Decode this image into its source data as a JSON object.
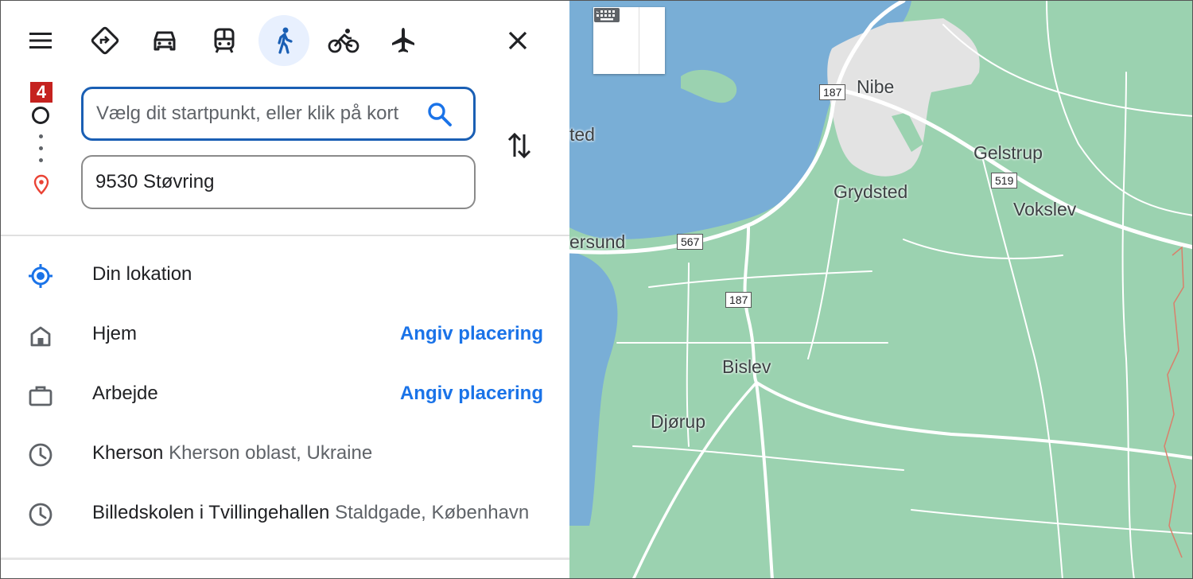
{
  "app": {
    "mode_count_badge": "4"
  },
  "travel_modes": [
    {
      "name": "best-route-icon",
      "active": false
    },
    {
      "name": "car-icon",
      "active": false
    },
    {
      "name": "transit-icon",
      "active": false
    },
    {
      "name": "walking-icon",
      "active": true
    },
    {
      "name": "bicycle-icon",
      "active": false
    },
    {
      "name": "flight-icon",
      "active": false
    }
  ],
  "inputs": {
    "start_placeholder": "Vælg dit startpunkt, eller klik på kort",
    "start_value": "",
    "destination_value": "9530 Støvring"
  },
  "suggestions": [
    {
      "icon": "my-location-icon",
      "name": "Din lokation",
      "sub": "",
      "action": ""
    },
    {
      "icon": "home-icon",
      "name": "Hjem",
      "sub": "",
      "action": "Angiv placering"
    },
    {
      "icon": "work-briefcase-icon",
      "name": "Arbejde",
      "sub": "",
      "action": "Angiv placering"
    },
    {
      "icon": "history-clock-icon",
      "name": "Kherson",
      "sub": "Kherson oblast, Ukraine",
      "action": ""
    },
    {
      "icon": "history-clock-icon",
      "name": "Billedskolen i Tvillingehallen",
      "sub": "Staldgade, København",
      "action": ""
    }
  ],
  "map": {
    "places": [
      "Nibe",
      "Gelstrup",
      "Grydsted",
      "Vokslev",
      "Bislev",
      "Djørup",
      "ted",
      "ersund"
    ],
    "road_shields": [
      "187",
      "519",
      "567",
      "187"
    ],
    "colors": {
      "land": "#9bd2b0",
      "water": "#79aed6",
      "town": "#e3e3e3",
      "road": "#ffffff",
      "active_mode": "#1a5fb4",
      "link": "#1a73e8"
    }
  }
}
